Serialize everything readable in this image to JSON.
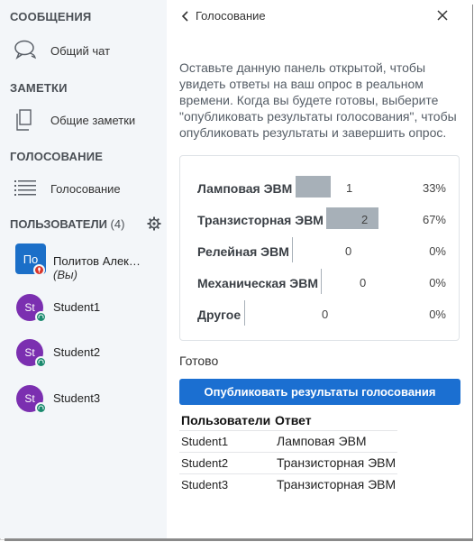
{
  "sidebar": {
    "messages_title": "СООБЩЕНИЯ",
    "public_chat": "Общий чат",
    "notes_title": "ЗАМЕТКИ",
    "shared_notes": "Общие заметки",
    "polling_title": "ГОЛОСОВАНИЕ",
    "polling_item": "Голосование",
    "users_title": "ПОЛЬЗОВАТЕЛИ",
    "users_count": "(4)",
    "users": [
      {
        "initials": "По",
        "name": "Политов Алек…",
        "you_label": "(Вы)",
        "avatar_color": "#1b6fc8"
      },
      {
        "initials": "St",
        "name": "Student1",
        "avatar_color": "#7b2fb0"
      },
      {
        "initials": "St",
        "name": "Student2",
        "avatar_color": "#7b2fb0"
      },
      {
        "initials": "St",
        "name": "Student3",
        "avatar_color": "#7b2fb0"
      }
    ]
  },
  "poll": {
    "header": "Голосование",
    "info": "Оставьте данную панель открытой, чтобы увидеть ответы на ваш опрос в реальном времени. Когда вы будете готовы, выберите \"опубликовать результаты голосования\", чтобы опубликовать результаты и завершить опрос.",
    "options": [
      {
        "label": "Ламповая ЭВМ",
        "count": "1",
        "percent": "33%",
        "fraction": 0.33
      },
      {
        "label": "Транзисторная ЭВМ",
        "count": "2",
        "percent": "67%",
        "fraction": 0.67
      },
      {
        "label": "Релейная ЭВМ",
        "count": "0",
        "percent": "0%",
        "fraction": 0
      },
      {
        "label": "Механическая ЭВМ",
        "count": "0",
        "percent": "0%",
        "fraction": 0
      },
      {
        "label": "Другое",
        "count": "0",
        "percent": "0%",
        "fraction": 0
      }
    ],
    "ready_label": "Готово",
    "publish_label": "Опубликовать результаты голосования",
    "table": {
      "col_users": "Пользователи",
      "col_answer": "Ответ",
      "rows": [
        {
          "user": "Student1",
          "answer": "Ламповая ЭВМ"
        },
        {
          "user": "Student2",
          "answer": "Транзисторная ЭВМ"
        },
        {
          "user": "Student3",
          "answer": "Транзисторная ЭВМ"
        }
      ]
    }
  },
  "colors": {
    "accent": "#1b6fd1",
    "bar": "#a7b0b8",
    "avatar_student": "#7b2fb0",
    "status_green": "#1a8a6e",
    "presenter_red": "#d9362b"
  }
}
